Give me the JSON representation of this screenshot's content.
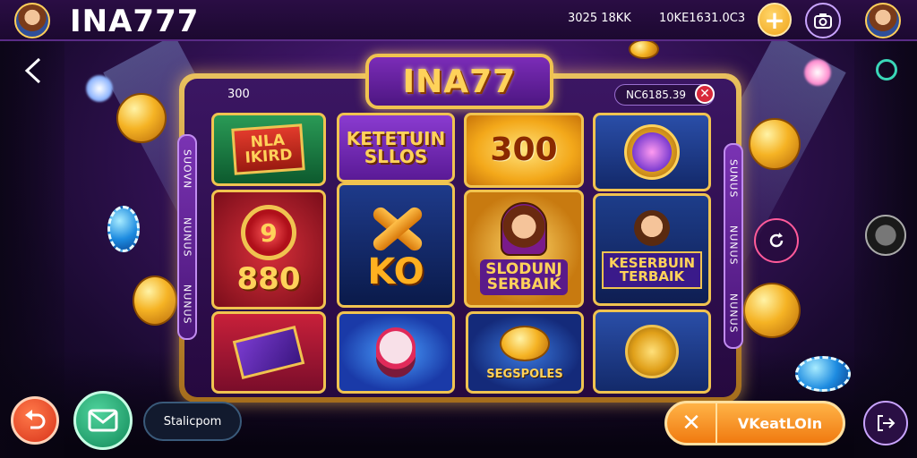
{
  "header": {
    "title": "INA777",
    "stat_left": "3025 18KK",
    "stat_right": "10KE1631.0C3",
    "plus_label": "+"
  },
  "frame": {
    "banner": "INA77",
    "left_value": "300",
    "right_value": "NC6185.39",
    "left_tab_text": [
      "SUOVN",
      "NUNUS",
      "NUNUS"
    ],
    "right_tab_text": [
      "SUNUS",
      "NUNUS",
      "NUNUS"
    ]
  },
  "tiles": [
    {
      "label": "NLA\nIKIRD",
      "name": "tile-nla-ikird"
    },
    {
      "label": "KETETUIN\nSLLOS",
      "name": "tile-ketetuin-sllos"
    },
    {
      "label": "300",
      "name": "tile-300"
    },
    {
      "label": "",
      "name": "tile-magic-mirror"
    },
    {
      "label": "880",
      "name": "tile-880"
    },
    {
      "label": "KO",
      "name": "tile-ko"
    },
    {
      "label": "SLODUNJ\nSERBAIK",
      "name": "tile-slodunj-serbaik"
    },
    {
      "label": "KESERBUIN\nTERBAIK",
      "name": "tile-keserbuin-terbaik"
    },
    {
      "label": "",
      "name": "tile-card"
    },
    {
      "label": "",
      "name": "tile-clown"
    },
    {
      "label": "SEGSPOLES",
      "name": "tile-segspoles"
    },
    {
      "label": "",
      "name": "tile-treasure"
    }
  ],
  "bottom": {
    "pill_label": "Stalicpom",
    "cta_label": "VKeatLOIn"
  },
  "colors": {
    "gold": "#f0c350",
    "purple": "#3b1663",
    "cta": "#f07a10"
  }
}
